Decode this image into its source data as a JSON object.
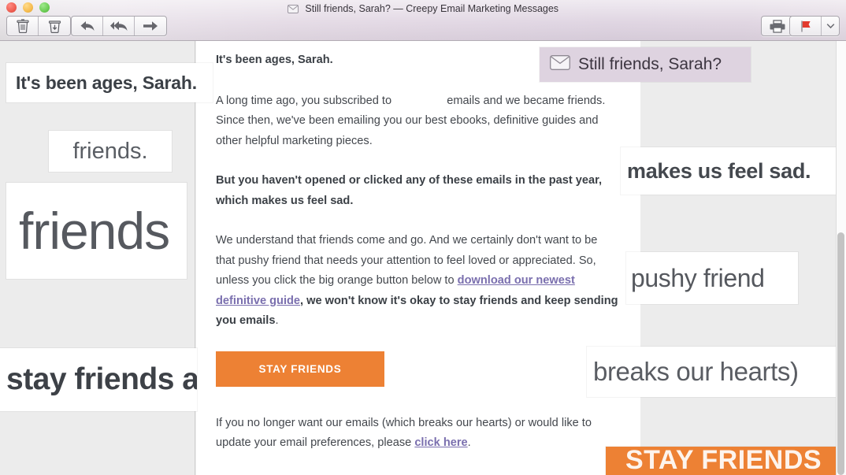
{
  "window": {
    "title": "Still friends, Sarah? — Creepy Email Marketing Messages",
    "title_icon": "envelope-icon",
    "traffic_lights": {
      "close_label": "Close",
      "minimize_label": "Minimize",
      "maximize_label": "Zoom"
    }
  },
  "toolbar": {
    "delete_label": "Delete",
    "junk_label": "Mark as Junk",
    "reply_label": "Reply",
    "reply_all_label": "Reply All",
    "forward_label": "Forward",
    "print_label": "Print",
    "flag_label": "Flag",
    "flag_menu_label": "Flag options",
    "flag_color": "#e23b2e",
    "icons": [
      "trash-icon",
      "junk-trash-icon",
      "reply-arrow-icon",
      "reply-all-arrow-icon",
      "forward-arrow-icon",
      "printer-icon",
      "flag-icon",
      "chevron-down-icon"
    ]
  },
  "email": {
    "greeting": "It's been ages, Sarah.",
    "para1_before": "A long time ago, you subscribed to",
    "para1_merge_field": "",
    "para1_after": "emails and we became friends. Since then, we've been emailing you our best ebooks, definitive guides and other helpful marketing pieces.",
    "para2": "But you haven't opened or clicked any of these emails in the past year, which makes us feel sad.",
    "para3_before": "We understand that friends come and go. And we certainly don't want to be that pushy friend that needs your attention to feel loved or appreciated. So, unless you click the big orange button below to ",
    "para3_link": "download our newest definitive guide",
    "para3_bold": ", we won't know it's okay to stay friends and keep sending you emails",
    "para3_end": ".",
    "cta_label": "STAY FRIENDS",
    "cta_color": "#ed8134",
    "footer_before": "If you no longer want our emails (which breaks our hearts) or would like to update your email preferences, please ",
    "footer_link": "click here",
    "footer_end": ".",
    "link_color": "#7a6fae"
  },
  "callouts": {
    "left": [
      {
        "text": "It's been ages, Sarah.",
        "name": "callout-greeting"
      },
      {
        "text": "friends.",
        "name": "callout-friends-period"
      },
      {
        "text": "friends",
        "name": "callout-friends-large"
      },
      {
        "text": "stay friends a",
        "name": "callout-stay-friends"
      }
    ],
    "right": [
      {
        "text": "Still friends, Sarah?",
        "name": "callout-subject",
        "icon": "envelope-icon"
      },
      {
        "text": "makes us feel sad.",
        "name": "callout-feel-sad"
      },
      {
        "text": "pushy friend",
        "name": "callout-pushy-friend"
      },
      {
        "text": "breaks our hearts)",
        "name": "callout-breaks-hearts"
      },
      {
        "text": "STAY FRIENDS",
        "name": "callout-cta"
      }
    ]
  },
  "scrollbar": {
    "position_label": "Vertical scrollbar"
  }
}
